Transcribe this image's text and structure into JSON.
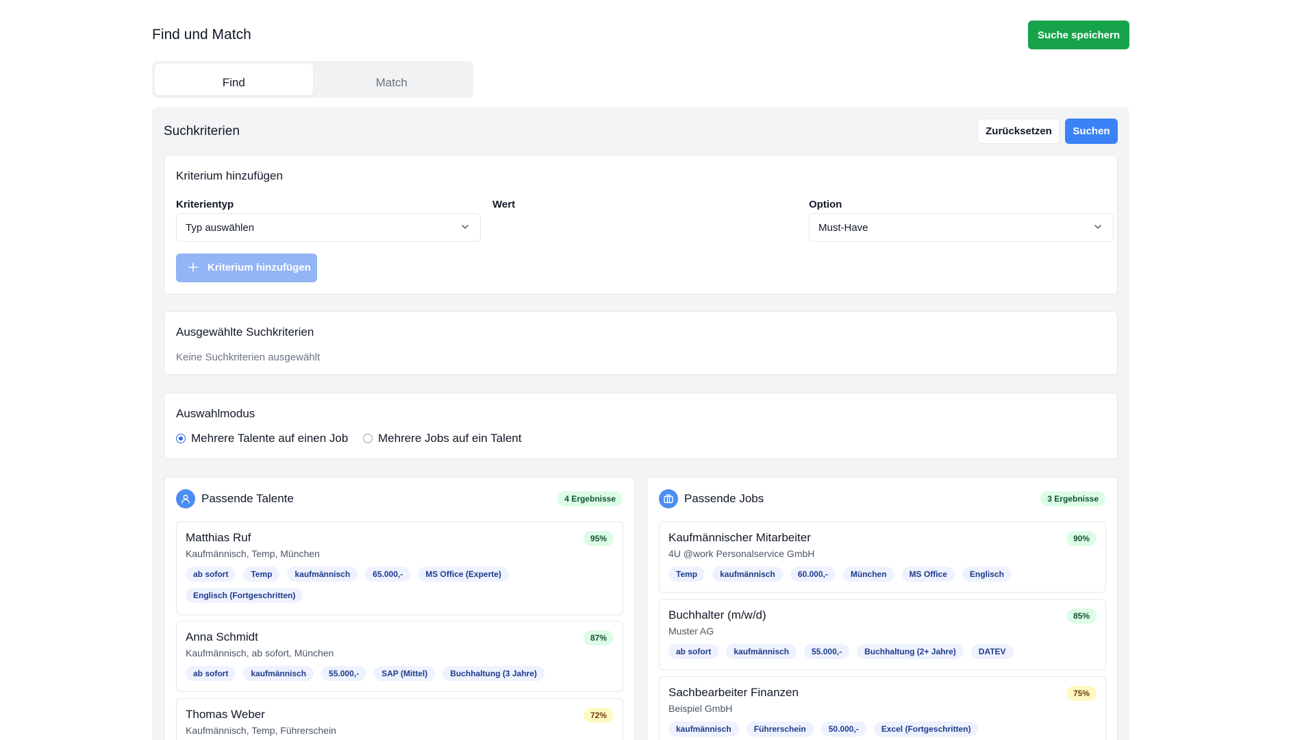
{
  "page": {
    "title": "Find und Match",
    "save_label": "Suche speichern"
  },
  "tabs": [
    {
      "label": "Find",
      "active": true
    },
    {
      "label": "Match",
      "active": false
    }
  ],
  "search": {
    "title": "Suchkriterien",
    "reset_label": "Zurücksetzen",
    "search_label": "Suchen"
  },
  "add_criterion": {
    "title": "Kriterium hinzufügen",
    "type_label": "Kriterientyp",
    "type_value": "Typ auswählen",
    "value_label": "Wert",
    "option_label": "Option",
    "option_value": "Must-Have",
    "button_label": "Kriterium hinzufügen"
  },
  "selected": {
    "title": "Ausgewählte Suchkriterien",
    "empty_text": "Keine Suchkriterien ausgewählt"
  },
  "mode": {
    "title": "Auswahlmodus",
    "options": [
      {
        "label": "Mehrere Talente auf einen Job",
        "checked": true
      },
      {
        "label": "Mehrere Jobs auf ein Talent",
        "checked": false
      }
    ]
  },
  "talents": {
    "title": "Passende Talente",
    "count": "4 Ergebnisse",
    "icon": "user-icon",
    "items": [
      {
        "name": "Matthias Ruf",
        "sub": "Kaufmännisch, Temp, München",
        "pct": "95%",
        "level": "high",
        "tags": [
          "ab sofort",
          "Temp",
          "kaufmännisch",
          "65.000,-",
          "MS Office (Experte)",
          "Englisch (Fortgeschritten)"
        ]
      },
      {
        "name": "Anna Schmidt",
        "sub": "Kaufmännisch, ab sofort, München",
        "pct": "87%",
        "level": "high",
        "tags": [
          "ab sofort",
          "kaufmännisch",
          "55.000,-",
          "SAP (Mittel)",
          "Buchhaltung (3 Jahre)"
        ]
      },
      {
        "name": "Thomas Weber",
        "sub": "Kaufmännisch, Temp, Führerschein",
        "pct": "72%",
        "level": "mid",
        "tags": []
      }
    ]
  },
  "jobs": {
    "title": "Passende Jobs",
    "count": "3 Ergebnisse",
    "icon": "briefcase-icon",
    "items": [
      {
        "name": "Kaufmännischer Mitarbeiter",
        "sub": "4U @work Personalservice GmbH",
        "pct": "90%",
        "level": "high",
        "tags": [
          "Temp",
          "kaufmännisch",
          "60.000,-",
          "München",
          "MS Office",
          "Englisch"
        ]
      },
      {
        "name": "Buchhalter (m/w/d)",
        "sub": "Muster AG",
        "pct": "85%",
        "level": "high",
        "tags": [
          "ab sofort",
          "kaufmännisch",
          "55.000,-",
          "Buchhaltung (2+ Jahre)",
          "DATEV"
        ]
      },
      {
        "name": "Sachbearbeiter Finanzen",
        "sub": "Beispiel GmbH",
        "pct": "75%",
        "level": "mid",
        "tags": [
          "kaufmännisch",
          "Führerschein",
          "50.000,-",
          "Excel (Fortgeschritten)"
        ]
      }
    ]
  },
  "colors": {
    "primary": "#3b82f6",
    "success": "#16a34a",
    "badge_green_bg": "#dcfce7",
    "badge_yellow_bg": "#fef9c3",
    "tag_bg": "#eef2ff"
  }
}
